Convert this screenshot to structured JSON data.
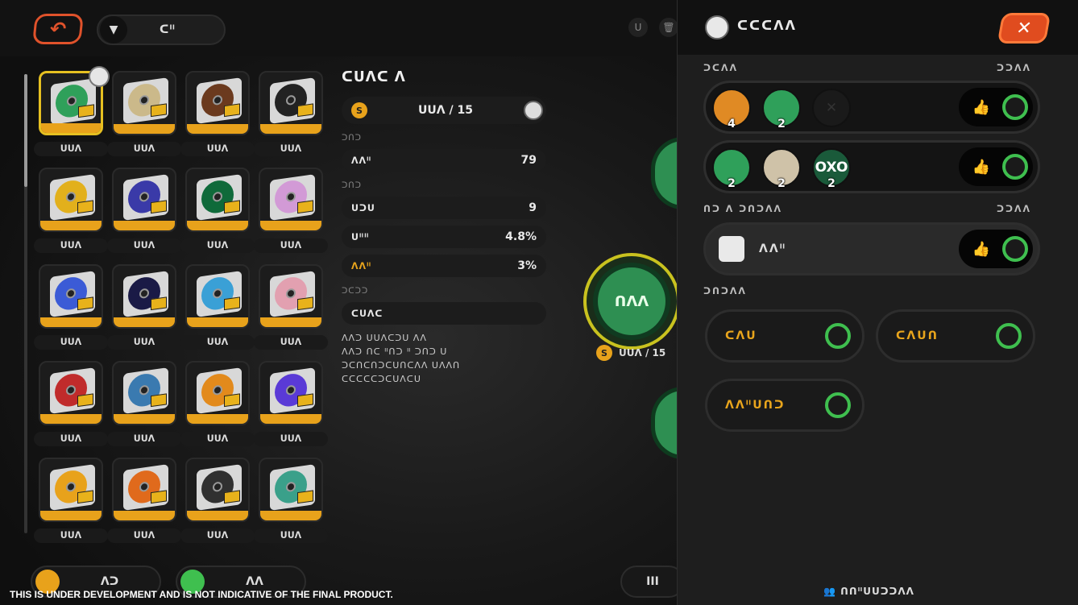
{
  "top": {
    "back_icon": "undo-arrow-icon",
    "filter_label": "ᑕᐦ",
    "icon_a": "ᑌ",
    "icon_b": "trash-icon"
  },
  "grid": {
    "tiles": [
      {
        "caption": "ᑌᑌᐱ",
        "art": "#2fa05a",
        "selected": true
      },
      {
        "caption": "ᑌᑌᐱ",
        "art": "#cbb98a"
      },
      {
        "caption": "ᑌᑌᐱ",
        "art": "#6b3a1e"
      },
      {
        "caption": "ᑌᑌᐱ",
        "art": "#222222"
      },
      {
        "caption": "ᑌᑌᐱ",
        "art": "#e2b01c"
      },
      {
        "caption": "ᑌᑌᐱ",
        "art": "#3a3aa8"
      },
      {
        "caption": "ᑌᑌᐱ",
        "art": "#0f6a3a"
      },
      {
        "caption": "ᑌᑌᐱ",
        "art": "#d29ad6"
      },
      {
        "caption": "ᑌᑌᐱ",
        "art": "#3b5bd6"
      },
      {
        "caption": "ᑌᑌᐱ",
        "art": "#1a1a46"
      },
      {
        "caption": "ᑌᑌᐱ",
        "art": "#3aa0d6"
      },
      {
        "caption": "ᑌᑌᐱ",
        "art": "#e2a0b0"
      },
      {
        "caption": "ᑌᑌᐱ",
        "art": "#c02b2b"
      },
      {
        "caption": "ᑌᑌᐱ",
        "art": "#3a7ab0"
      },
      {
        "caption": "ᑌᑌᐱ",
        "art": "#e28a1c"
      },
      {
        "caption": "ᑌᑌᐱ",
        "art": "#5a3ad6"
      },
      {
        "caption": "ᑌᑌᐱ",
        "art": "#e8a21b"
      },
      {
        "caption": "ᑌᑌᐱ",
        "art": "#e06a1c"
      },
      {
        "caption": "ᑌᑌᐱ",
        "art": "#303030"
      },
      {
        "caption": "ᑌᑌᐱ",
        "art": "#3aa08a"
      }
    ]
  },
  "detail": {
    "title": "ᑕᑌᐱᑕ ᐱ",
    "progress": "ᑌᑌᐱ / 15",
    "section1": "ᑐᑎᑐ",
    "stat1_label": "ᐱᐱᐦ",
    "stat1_value": "79",
    "section2": "ᑐᑎᑐ",
    "stat2_label": "ᑌᑐᑌ",
    "stat2_value": "9",
    "stat3_label": "ᑌᐦᐦ",
    "stat3_value": "4.8%",
    "stat4_label": "ᐱᐱᐦ",
    "stat4_value": "3%",
    "section3": "ᑐᑕᑐᑐ",
    "tag_label": "ᑕᑌᐱᑕ",
    "desc_lines": [
      "ᐱᐱᑐ ᑌᑌᐱᑕᑐᑌ ᐱᐱ",
      "ᐱᐱᑐ ᑎᑕ ᐦᑎᑐ ᐦ ᑐᑎᑐ ᑌ",
      "ᑐᑕᑎᑕᑎᑐᑕᑌᑎᑕᐱᐱ ᑌᐱᐱᑎ",
      "ᑕᑕᑕᑕᑕᑐᑕᑌᐱᑕᑌ"
    ]
  },
  "center": {
    "disc_text": "ᑎᐱᐱ",
    "progress": "ᑌᑌᐱ / 15"
  },
  "panel": {
    "title": "ᑕᑕᑕᐱᐱ",
    "close_icon": "close-x-icon",
    "sec1_left": "ᑐᑕᐱᐱ",
    "sec1_right": "ᑐᑐᐱᐱ",
    "row1": [
      {
        "count": "4",
        "color": "#e08a24"
      },
      {
        "count": "2",
        "color": "#2fa05a"
      },
      {
        "count": "",
        "color": "#1a1a1a"
      }
    ],
    "row2": [
      {
        "count": "2",
        "color": "#2fa05a"
      },
      {
        "count": "2",
        "color": "#cfc2a8"
      },
      {
        "count": "2",
        "color": "#1a5a3a",
        "chars": "OXO"
      }
    ],
    "sec2_left": "ᑎᑐ ᐱ ᑐᑎᑐᐱᐱ",
    "sec2_right": "ᑐᑐᐱᐱ",
    "wide_label": "ᐱᐱᐦ",
    "sec3_label": "ᑐᑎᑐᐱᐱ",
    "opt1": "ᑕᐱᑌ",
    "opt2": "ᑕᐱᑌᑎ",
    "opt3": "ᐱᐱᐦᑌᑎᑐ",
    "friends": "ᑎᑎᐦᑌᑌᑐᑐᐱᐱ"
  },
  "bottom": {
    "left_label": "ᐱᑐ",
    "mid_label": "ᐱᐱ",
    "notice": "THIS IS UNDER DEVELOPMENT AND IS NOT INDICATIVE OF THE FINAL PRODUCT."
  }
}
